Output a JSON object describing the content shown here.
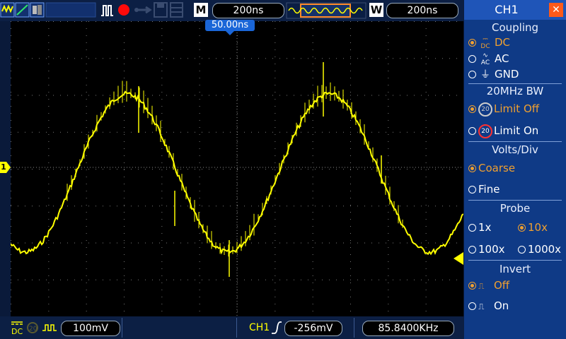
{
  "top": {
    "mode_label": "M",
    "timebase": "200ns",
    "window_label": "W",
    "window_timebase": "200ns",
    "trigger_pos": "50.00ns"
  },
  "panel": {
    "title": "CH1",
    "coupling": {
      "header": "Coupling",
      "options": [
        "DC",
        "AC",
        "GND"
      ],
      "selected": "DC"
    },
    "bw": {
      "header": "20MHz BW",
      "options": [
        "Limit Off",
        "Limit On"
      ],
      "selected": "Limit Off",
      "icon_text": "20"
    },
    "volts": {
      "header": "Volts/Div",
      "options": [
        "Coarse",
        "Fine"
      ],
      "selected": "Coarse"
    },
    "probe": {
      "header": "Probe",
      "options": [
        "1x",
        "10x",
        "100x",
        "1000x"
      ],
      "selected": "10x"
    },
    "invert": {
      "header": "Invert",
      "options": [
        "Off",
        "On"
      ],
      "selected": "Off"
    }
  },
  "bottom": {
    "volts": "100mV",
    "trig_source": "CH1",
    "trig_level": "-256mV",
    "frequency": "85.8400KHz"
  },
  "markers": {
    "ch1": "1"
  },
  "colors": {
    "trace": "#ffff00",
    "accent": "#f0a030",
    "panel": "#0f3a86"
  }
}
